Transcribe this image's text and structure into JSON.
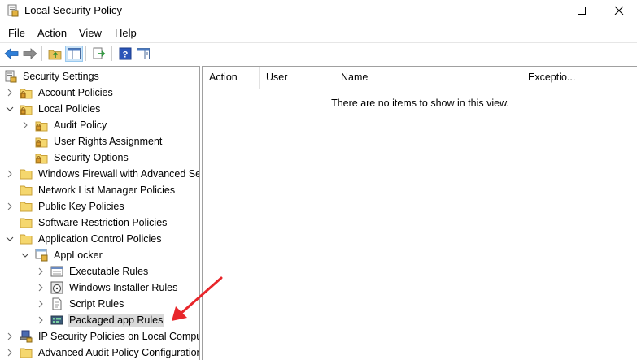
{
  "window": {
    "title": "Local Security Policy"
  },
  "menu": [
    "File",
    "Action",
    "View",
    "Help"
  ],
  "toolbar": {
    "buttons": [
      "back-arrow-icon",
      "forward-arrow-icon",
      "up-folder-icon",
      "show-hide-tree-icon",
      "export-list-icon",
      "help-icon",
      "action-pane-icon"
    ]
  },
  "tree": {
    "root": "Security Settings",
    "items": [
      {
        "label": "Account Policies"
      },
      {
        "label": "Local Policies"
      },
      {
        "label": "Audit Policy"
      },
      {
        "label": "User Rights Assignment"
      },
      {
        "label": "Security Options"
      },
      {
        "label": "Windows Firewall with Advanced Security"
      },
      {
        "label": "Network List Manager Policies"
      },
      {
        "label": "Public Key Policies"
      },
      {
        "label": "Software Restriction Policies"
      },
      {
        "label": "Application Control Policies"
      },
      {
        "label": "AppLocker"
      },
      {
        "label": "Executable Rules"
      },
      {
        "label": "Windows Installer Rules"
      },
      {
        "label": "Script Rules"
      },
      {
        "label": "Packaged app Rules",
        "selected": true
      },
      {
        "label": "IP Security Policies on Local Computer"
      },
      {
        "label": "Advanced Audit Policy Configuration"
      }
    ]
  },
  "list": {
    "columns": [
      "Action",
      "User",
      "Name",
      "Exceptio..."
    ],
    "empty_message": "There are no items to show in this view."
  },
  "colors": {
    "annotation_arrow": "#e8262b",
    "selection": "#d9d9d9",
    "folder": "#f5d76e"
  }
}
